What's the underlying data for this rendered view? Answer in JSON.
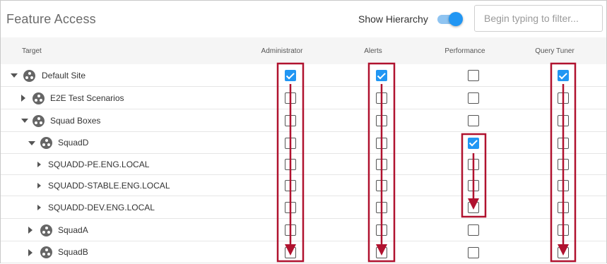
{
  "header": {
    "title": "Feature Access",
    "show_hierarchy_label": "Show Hierarchy",
    "show_hierarchy_on": true,
    "filter_placeholder": "Begin typing to filter...",
    "filter_value": ""
  },
  "columns": {
    "target": "Target",
    "administrator": "Administrator",
    "alerts": "Alerts",
    "performance": "Performance",
    "query_tuner": "Query Tuner"
  },
  "rows": [
    {
      "label": "Default Site",
      "level": 0,
      "expanded": true,
      "icon": "site-icon",
      "administrator": true,
      "alerts": true,
      "performance": false,
      "query_tuner": true
    },
    {
      "label": "E2E Test Scenarios",
      "level": 1,
      "expanded": false,
      "icon": "site-icon",
      "administrator": false,
      "alerts": false,
      "performance": false,
      "query_tuner": false
    },
    {
      "label": "Squad Boxes",
      "level": 1,
      "expanded": true,
      "icon": "site-icon",
      "administrator": false,
      "alerts": false,
      "performance": false,
      "query_tuner": false
    },
    {
      "label": "SquadD",
      "level": 2,
      "expanded": true,
      "icon": "site-icon",
      "administrator": false,
      "alerts": false,
      "performance": true,
      "query_tuner": false
    },
    {
      "label": "SQUADD-PE.ENG.LOCAL",
      "level": 3,
      "expanded": false,
      "icon": "",
      "administrator": false,
      "alerts": false,
      "performance": false,
      "query_tuner": false
    },
    {
      "label": "SQUADD-STABLE.ENG.LOCAL",
      "level": 3,
      "expanded": false,
      "icon": "",
      "administrator": false,
      "alerts": false,
      "performance": false,
      "query_tuner": false
    },
    {
      "label": "SQUADD-DEV.ENG.LOCAL",
      "level": 3,
      "expanded": false,
      "icon": "",
      "administrator": false,
      "alerts": false,
      "performance": false,
      "query_tuner": false
    },
    {
      "label": "SquadA",
      "level": 2,
      "expanded": false,
      "icon": "site-icon",
      "administrator": false,
      "alerts": false,
      "performance": false,
      "query_tuner": false
    },
    {
      "label": "SquadB",
      "level": 2,
      "expanded": false,
      "icon": "site-icon",
      "administrator": false,
      "alerts": false,
      "performance": false,
      "query_tuner": false
    }
  ],
  "colors": {
    "accent": "#2196f3",
    "toggle_track": "#8fc4f1",
    "annotation": "#b0122f",
    "header_bg": "#f5f5f5"
  }
}
